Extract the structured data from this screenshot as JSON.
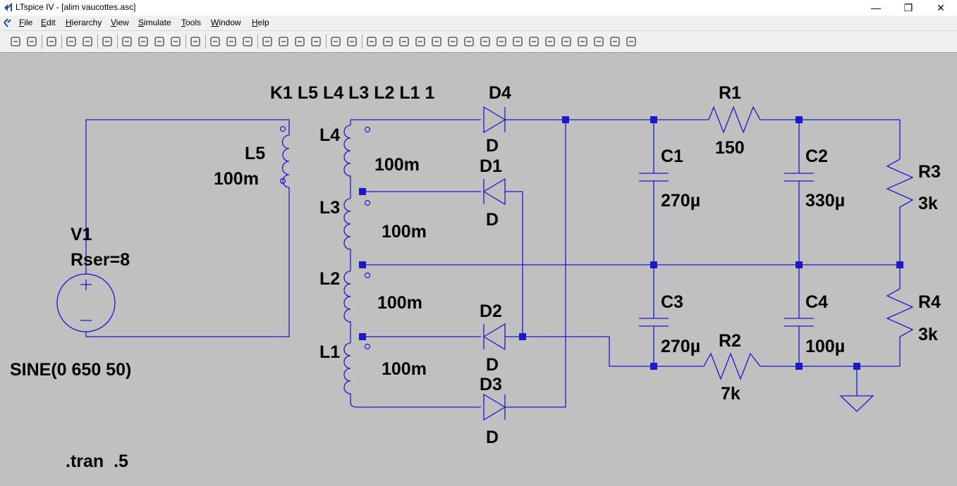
{
  "window": {
    "title": "LTspice IV - [alim vaucottes.asc]"
  },
  "menu": [
    "File",
    "Edit",
    "Hierarchy",
    "View",
    "Simulate",
    "Tools",
    "Window",
    "Help"
  ],
  "toolbar_icons": [
    "new-schematic-icon",
    "open-icon",
    "save-icon",
    "control-panel-icon",
    "run-icon",
    "halt-icon",
    "zoom-in-icon",
    "zoom-pan-icon",
    "zoom-out-icon",
    "zoom-fit-icon",
    "autorange-icon",
    "fft-icon",
    "tile-icon",
    "cascade-icon",
    "close-all-icon",
    "cut-icon",
    "copy-icon",
    "paste-icon",
    "find-icon",
    "print-setup-icon",
    "print-icon",
    "draw-wire-icon",
    "ground-icon",
    "label-net-icon",
    "resistor-icon",
    "capacitor-icon",
    "inductor-icon",
    "diode-icon",
    "component-icon",
    "move-icon",
    "drag-icon",
    "undo-icon",
    "redo-icon",
    "rotate-icon",
    "mirror-icon",
    "text-icon",
    "spice-directive-icon"
  ],
  "schematic": {
    "k_statement": "K1 L5 L4  L3 L2 L1 1",
    "v1": {
      "name": "V1",
      "param": "Rser=8",
      "source": "SINE(0 650 50)"
    },
    "l5": {
      "name": "L5",
      "value": "100m"
    },
    "l4": {
      "name": "L4",
      "value": "100m"
    },
    "l3": {
      "name": "L3",
      "value": "100m"
    },
    "l2": {
      "name": "L2",
      "value": "100m"
    },
    "l1": {
      "name": "L1",
      "value": "100m"
    },
    "d4": {
      "name": "D4",
      "model": "D"
    },
    "d1": {
      "name": "D1",
      "model": "D"
    },
    "d2": {
      "name": "D2",
      "model": "D"
    },
    "d3": {
      "name": "D3",
      "model": "D"
    },
    "r1": {
      "name": "R1",
      "value": "150"
    },
    "r2": {
      "name": "R2",
      "value": "7k"
    },
    "r3": {
      "name": "R3",
      "value": "3k"
    },
    "r4": {
      "name": "R4",
      "value": "3k"
    },
    "c1": {
      "name": "C1",
      "value": "270µ"
    },
    "c2": {
      "name": "C2",
      "value": "330µ"
    },
    "c3": {
      "name": "C3",
      "value": "270µ"
    },
    "c4": {
      "name": "C4",
      "value": "100µ"
    },
    "directive": ".tran  .5"
  }
}
